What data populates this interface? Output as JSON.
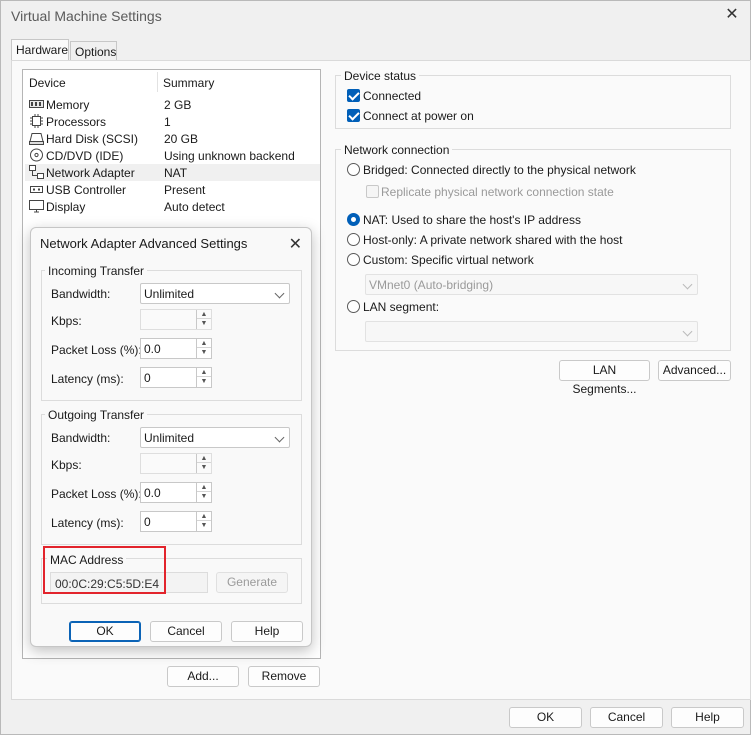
{
  "window": {
    "title": "Virtual Machine Settings",
    "close_glyph": "✕"
  },
  "tabs": [
    {
      "label": "Hardware",
      "active": true
    },
    {
      "label": "Options",
      "active": false
    }
  ],
  "device_list": {
    "headers": {
      "device": "Device",
      "summary": "Summary"
    },
    "rows": [
      {
        "device": "Memory",
        "summary": "2 GB",
        "icon": "memory-icon"
      },
      {
        "device": "Processors",
        "summary": "1",
        "icon": "processor-icon"
      },
      {
        "device": "Hard Disk (SCSI)",
        "summary": "20 GB",
        "icon": "hard-disk-icon"
      },
      {
        "device": "CD/DVD (IDE)",
        "summary": "Using unknown backend",
        "icon": "cd-dvd-icon"
      },
      {
        "device": "Network Adapter",
        "summary": "NAT",
        "icon": "network-adapter-icon",
        "selected": true
      },
      {
        "device": "USB Controller",
        "summary": "Present",
        "icon": "usb-icon"
      },
      {
        "device": "Display",
        "summary": "Auto detect",
        "icon": "display-icon"
      }
    ],
    "add_label": "Add...",
    "remove_label": "Remove"
  },
  "device_status": {
    "label": "Device status",
    "connected": {
      "label": "Connected",
      "checked": true
    },
    "connect_at_power_on": {
      "label": "Connect at power on",
      "checked": true
    }
  },
  "network_connection": {
    "label": "Network connection",
    "bridged": "Bridged: Connected directly to the physical network",
    "replicate": "Replicate physical network connection state",
    "nat": "NAT: Used to share the host's IP address",
    "host_only": "Host-only: A private network shared with the host",
    "custom": "Custom: Specific virtual network",
    "custom_value": "VMnet0 (Auto-bridging)",
    "lan_segment": "LAN segment:",
    "lan_segment_value": "",
    "selected": "nat"
  },
  "right_buttons": {
    "lan_segments": "LAN Segments...",
    "advanced": "Advanced..."
  },
  "footer": {
    "ok": "OK",
    "cancel": "Cancel",
    "help": "Help"
  },
  "dialog": {
    "title": "Network Adapter Advanced Settings",
    "incoming": {
      "label": "Incoming Transfer",
      "bandwidth_label": "Bandwidth:",
      "bandwidth_value": "Unlimited",
      "kbps_label": "Kbps:",
      "kbps_value": "",
      "loss_label": "Packet Loss (%):",
      "loss_value": "0.0",
      "latency_label": "Latency (ms):",
      "latency_value": "0"
    },
    "outgoing": {
      "label": "Outgoing Transfer",
      "bandwidth_label": "Bandwidth:",
      "bandwidth_value": "Unlimited",
      "kbps_label": "Kbps:",
      "kbps_value": "",
      "loss_label": "Packet Loss (%):",
      "loss_value": "0.0",
      "latency_label": "Latency (ms):",
      "latency_value": "0"
    },
    "mac": {
      "label": "MAC Address",
      "value": "00:0C:29:C5:5D:E4",
      "generate_label": "Generate"
    },
    "ok": "OK",
    "cancel": "Cancel",
    "help": "Help",
    "close_glyph": "✕"
  },
  "colors": {
    "accent": "#005fb8",
    "highlight_box": "#e2242c"
  }
}
